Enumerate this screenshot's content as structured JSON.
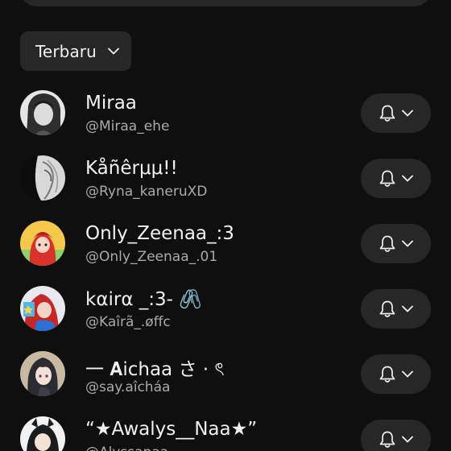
{
  "sort": {
    "label": "Terbaru",
    "chevron_icon": "chevron-down-icon"
  },
  "subscriptions": [
    {
      "name": "Miraa",
      "handle": "@Miraa_ehe",
      "avatar_colors": [
        "#d9d9d9",
        "#3a3a3a"
      ]
    },
    {
      "name": "Kåñêrμμ!!",
      "handle": "@Ryna_kaneruXD",
      "avatar_colors": [
        "#111111",
        "#e0e0e0"
      ]
    },
    {
      "name": "Only_Zeenaa_:3",
      "handle": "@Only_Zeenaa_.01",
      "avatar_colors": [
        "#f4c84a",
        "#d9322b"
      ]
    },
    {
      "name": "kαirα _:3- 🖇️",
      "handle": "@Kaîrã_.øffc",
      "avatar_colors": [
        "#4fb6e8",
        "#c62626"
      ]
    },
    {
      "name": "一 𝐀ichaa さ · ৎ",
      "handle": "@say.aîcháa",
      "avatar_colors": [
        "#c8b9a0",
        "#2b2b34"
      ]
    },
    {
      "name": "“★Awalys__Naa★”",
      "handle": "@Alyssanaa",
      "avatar_colors": [
        "#f2f2f2",
        "#2d5a3a"
      ]
    }
  ],
  "icons": {
    "bell": "bell-icon",
    "chevron": "chevron-down-icon"
  },
  "colors": {
    "background": "#0f0f0f",
    "surface": "#272727",
    "text_primary": "#f1f1f1",
    "text_secondary": "#aaaaaa"
  }
}
